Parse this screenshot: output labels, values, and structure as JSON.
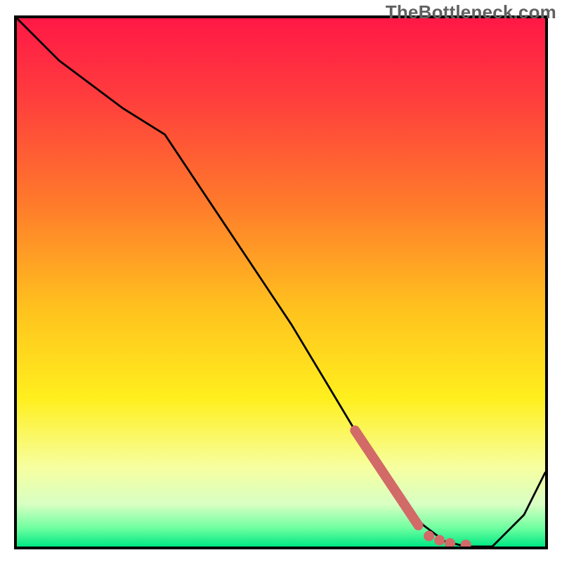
{
  "watermark": "TheBottleneck.com",
  "colors": {
    "frame_border": "#000000",
    "curve_stroke": "#000000",
    "highlight_stroke": "#d26a68",
    "highlight_dot": "#d26a68",
    "gradient_stops": [
      {
        "offset": 0.0,
        "color": "#ff1846"
      },
      {
        "offset": 0.15,
        "color": "#ff3d3d"
      },
      {
        "offset": 0.35,
        "color": "#ff7a2b"
      },
      {
        "offset": 0.55,
        "color": "#ffc21e"
      },
      {
        "offset": 0.72,
        "color": "#ffef1e"
      },
      {
        "offset": 0.85,
        "color": "#f7ffa0"
      },
      {
        "offset": 0.92,
        "color": "#d8ffc3"
      },
      {
        "offset": 0.965,
        "color": "#6fffa0"
      },
      {
        "offset": 1.0,
        "color": "#00e884"
      }
    ]
  },
  "chart_data": {
    "type": "line",
    "title": "",
    "xlabel": "",
    "ylabel": "",
    "xlim": [
      0,
      100
    ],
    "ylim": [
      0,
      100
    ],
    "x": [
      0,
      8,
      20,
      28,
      36,
      44,
      52,
      58,
      64,
      69,
      73,
      77,
      81,
      85,
      90,
      96,
      100
    ],
    "values": [
      100,
      92,
      83,
      78,
      66,
      54,
      42,
      32,
      22,
      14,
      8,
      4,
      1,
      0,
      0,
      6,
      14
    ],
    "annotations": {
      "highlight_segment": {
        "x": [
          64,
          66,
          68,
          70,
          72,
          74,
          76
        ],
        "values": [
          22,
          19,
          16,
          13,
          10,
          7,
          4
        ]
      },
      "highlight_dots": {
        "x": [
          78,
          80,
          82,
          85
        ],
        "values": [
          2,
          1.2,
          0.6,
          0.3
        ]
      }
    }
  }
}
